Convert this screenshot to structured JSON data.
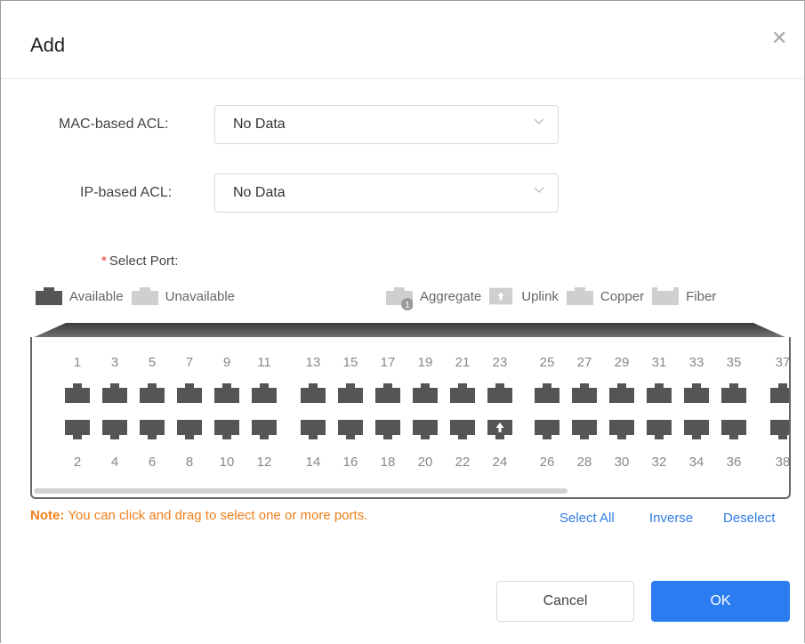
{
  "dialog": {
    "title": "Add",
    "close_icon": "close-icon"
  },
  "form": {
    "mac_acl": {
      "label": "MAC-based ACL:",
      "value": "No Data"
    },
    "ip_acl": {
      "label": "IP-based ACL:",
      "value": "No Data"
    },
    "select_port": {
      "required_mark": "*",
      "label": "Select Port:"
    }
  },
  "legend": [
    {
      "label": "Available",
      "icon": "port-available-icon"
    },
    {
      "label": "Unavailable",
      "icon": "port-unavailable-icon"
    },
    {
      "label": "Aggregate",
      "icon": "port-aggregate-icon",
      "badge": "1"
    },
    {
      "label": "Uplink",
      "icon": "port-uplink-icon"
    },
    {
      "label": "Copper",
      "icon": "port-copper-icon"
    },
    {
      "label": "Fiber",
      "icon": "port-fiber-icon"
    }
  ],
  "ports": {
    "top": [
      "1",
      "3",
      "5",
      "7",
      "9",
      "11",
      "13",
      "15",
      "17",
      "19",
      "21",
      "23",
      "25",
      "27",
      "29",
      "31",
      "33",
      "35",
      "37"
    ],
    "bottom": [
      "2",
      "4",
      "6",
      "8",
      "10",
      "12",
      "14",
      "16",
      "18",
      "20",
      "22",
      "24",
      "26",
      "28",
      "30",
      "32",
      "34",
      "36",
      "38"
    ],
    "uplink_port": "24"
  },
  "note": {
    "prefix": "Note:",
    "text": " You can click and drag to select one or more ports."
  },
  "actions": {
    "select_all": "Select All",
    "inverse": "Inverse",
    "deselect": "Deselect"
  },
  "buttons": {
    "cancel": "Cancel",
    "ok": "OK"
  },
  "colors": {
    "accent": "#2a7cf0",
    "note": "#f07f1a",
    "required": "#e33333",
    "port_available": "#555555",
    "port_unavailable": "#cfcfcf"
  }
}
